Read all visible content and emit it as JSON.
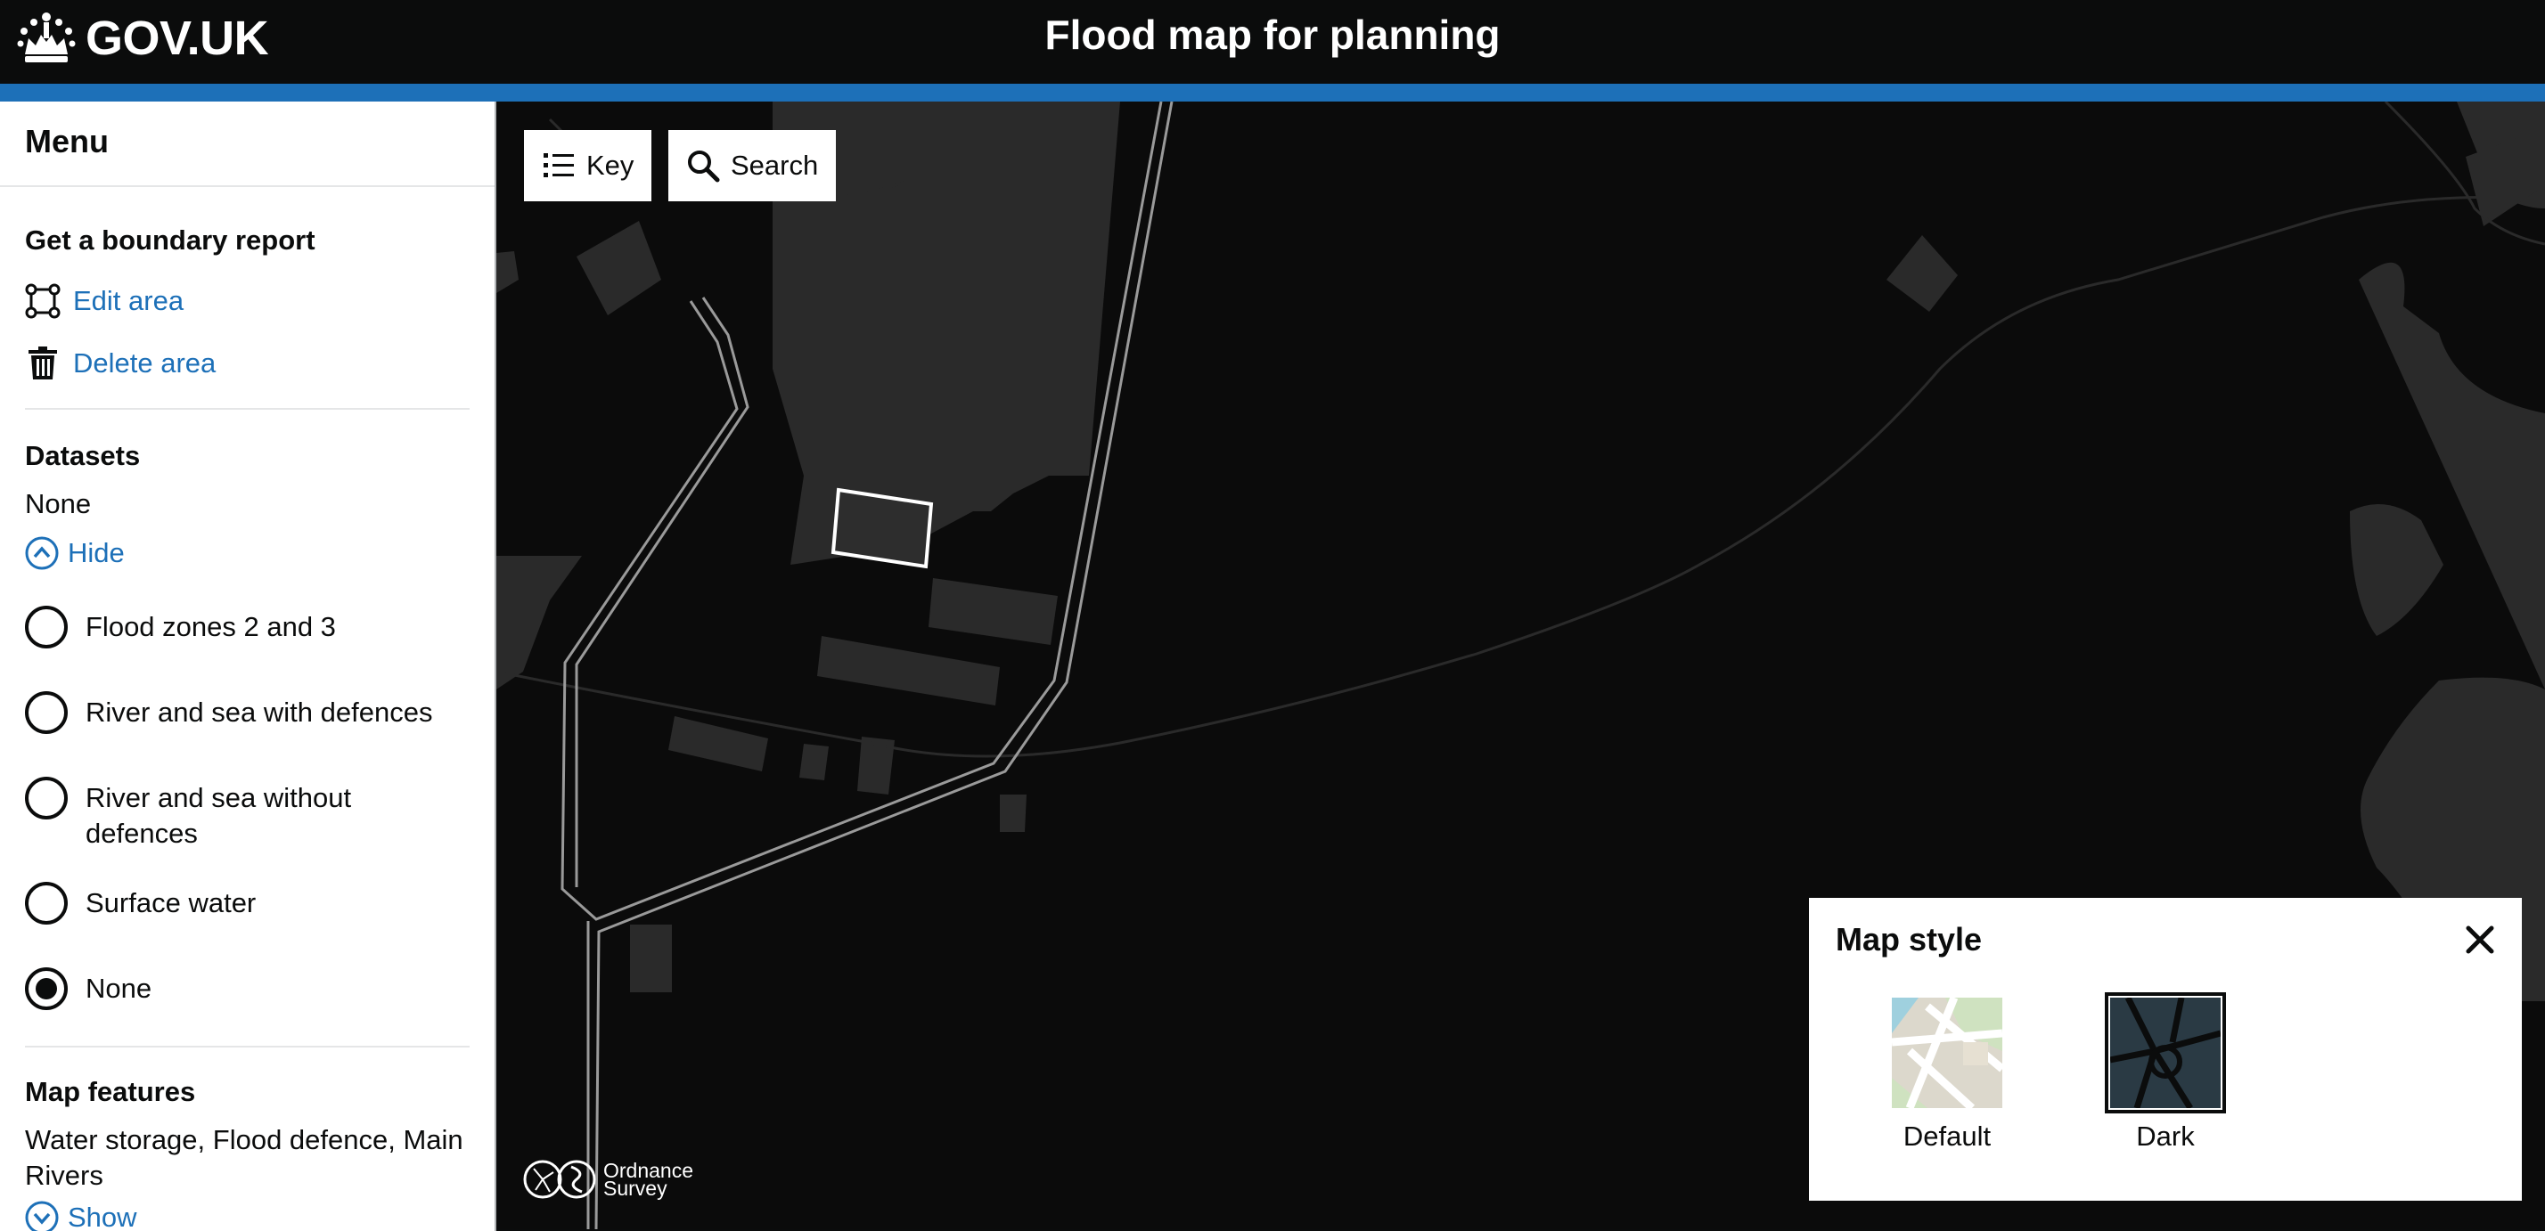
{
  "header": {
    "logo_text": "GOV.UK",
    "title": "Flood map for planning"
  },
  "sidebar": {
    "menu_title": "Menu",
    "boundary": {
      "title": "Get a boundary report",
      "edit_label": "Edit area",
      "delete_label": "Delete area"
    },
    "datasets": {
      "title": "Datasets",
      "selected_summary": "None",
      "toggle_label": "Hide",
      "options": [
        {
          "label": "Flood zones 2 and 3",
          "selected": false
        },
        {
          "label": "River and sea with defences",
          "selected": false
        },
        {
          "label": "River and sea without defences",
          "selected": false
        },
        {
          "label": "Surface water",
          "selected": false
        },
        {
          "label": "None",
          "selected": true
        }
      ]
    },
    "map_features": {
      "title": "Map features",
      "summary": "Water storage, Flood defence, Main Rivers",
      "toggle_label": "Show"
    }
  },
  "map": {
    "key_button": "Key",
    "search_button": "Search",
    "attribution_line1": "Ordnance",
    "attribution_line2": "Survey",
    "style_panel": {
      "title": "Map style",
      "options": [
        {
          "label": "Default",
          "selected": false
        },
        {
          "label": "Dark",
          "selected": true
        }
      ]
    }
  },
  "colors": {
    "header_bg": "#0b0c0c",
    "accent_blue": "#1d70b8",
    "link": "#1d70b8",
    "map_bg": "#0b0b0b",
    "map_features": "#2b2b2b"
  },
  "icons": {
    "logo": "crown-icon",
    "edit": "edit-area-icon",
    "delete": "trash-icon",
    "hide": "chevron-up-icon",
    "show": "chevron-down-icon",
    "key": "list-icon",
    "search": "search-icon",
    "close": "close-icon"
  }
}
